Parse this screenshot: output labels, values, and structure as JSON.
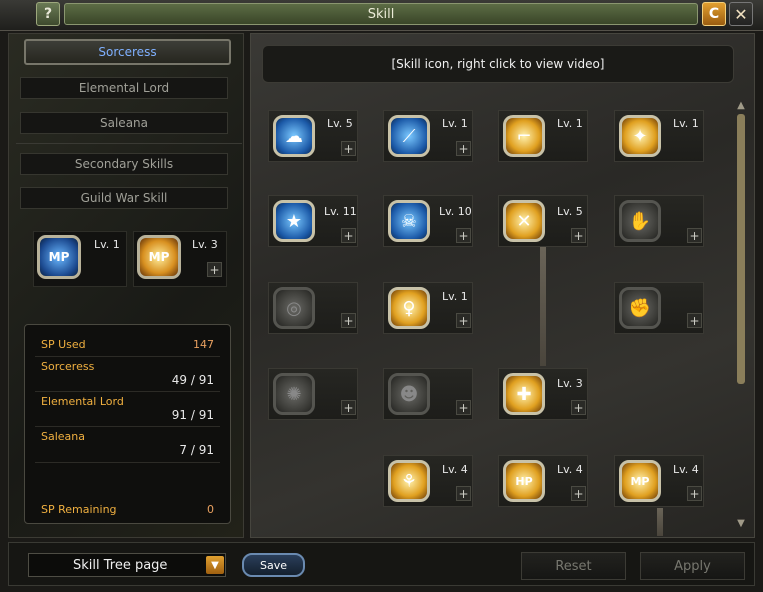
{
  "window": {
    "title": "Skill",
    "help_label": "?",
    "refresh_label": "C",
    "close_label": "✕"
  },
  "class_tabs": [
    {
      "label": "Sorceress",
      "active": true
    },
    {
      "label": "Elemental Lord",
      "active": false
    },
    {
      "label": "Saleana",
      "active": false
    },
    {
      "label": "Secondary Skills",
      "active": false
    },
    {
      "label": "Guild War Skill",
      "active": false
    }
  ],
  "passives": [
    {
      "icon": "mp-icon",
      "icon_text": "MP",
      "level": "Lv. 1"
    },
    {
      "icon": "mp-boost-icon",
      "icon_text": "MP",
      "level": "Lv. 3"
    }
  ],
  "sp": {
    "used_label": "SP Used",
    "used_value": "147",
    "rows": [
      {
        "label": "Sorceress",
        "value": "49 / 91"
      },
      {
        "label": "Elemental Lord",
        "value": "91 / 91"
      },
      {
        "label": "Saleana",
        "value": "7 / 91"
      }
    ],
    "remaining_label": "SP Remaining",
    "remaining_value": "0"
  },
  "info_bar": "[Skill icon, right click to view video]",
  "skills": [
    {
      "level": "Lv. 5",
      "icon": "wind-icon"
    },
    {
      "level": "Lv. 1",
      "icon": "staff-icon"
    },
    {
      "level": "Lv. 1",
      "icon": "boot-icon"
    },
    {
      "level": "Lv. 1",
      "icon": "phoenix-icon"
    },
    {
      "level": "Lv. 11",
      "icon": "star-icon"
    },
    {
      "level": "Lv. 10",
      "icon": "skull-icon"
    },
    {
      "level": "Lv. 5",
      "icon": "cross-icon"
    },
    {
      "level": "",
      "icon": "locked-hand-icon"
    },
    {
      "level": "",
      "icon": "locked-swirl-icon"
    },
    {
      "level": "Lv. 1",
      "icon": "figure-icon"
    },
    {
      "level": "",
      "icon": "locked-fist-icon"
    },
    {
      "level": "",
      "icon": "locked-burst-icon"
    },
    {
      "level": "",
      "icon": "locked-face-icon"
    },
    {
      "level": "Lv. 3",
      "icon": "body-icon"
    },
    {
      "level": "Lv. 4",
      "icon": "dance-icon"
    },
    {
      "level": "Lv. 4",
      "icon": "hp-icon"
    },
    {
      "level": "Lv. 4",
      "icon": "mp-up-icon"
    }
  ],
  "skill_icon_text": {
    "hp": "HP",
    "mp": "MP"
  },
  "plus_label": "+",
  "bottom": {
    "page_select": "Skill Tree page",
    "dropdown_arrow": "▼",
    "save": "Save",
    "reset": "Reset",
    "apply": "Apply"
  },
  "scroll": {
    "up": "▲",
    "down": "▼"
  }
}
